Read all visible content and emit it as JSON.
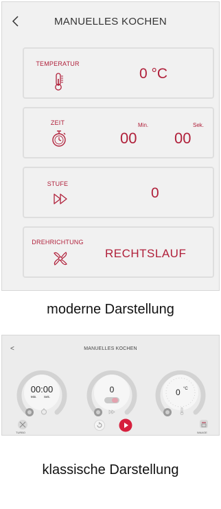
{
  "modern": {
    "back_glyph": "<",
    "title": "MANUELLES KOCHEN",
    "temperature": {
      "label": "TEMPERATUR",
      "value": "0 °C"
    },
    "time": {
      "label": "ZEIT",
      "minutes": "00",
      "minutes_unit": "Min.",
      "seconds": "00",
      "seconds_unit": "Sek."
    },
    "speed": {
      "label": "STUFE",
      "value": "0"
    },
    "direction": {
      "label": "DREHRICHTUNG",
      "value": "RECHTSLAUF"
    }
  },
  "caption_modern": "moderne Darstellung",
  "classic": {
    "back_glyph": "<",
    "title": "MANUELLES KOCHEN",
    "time_dial": {
      "value": "00:00",
      "min_label": "Min.",
      "sec_label": "Sek."
    },
    "speed_dial": {
      "value": "0"
    },
    "temp_dial": {
      "value": "0",
      "unit": "°C"
    },
    "turbo_label": "TURBO",
    "scale_label": "WAAGE"
  },
  "caption_classic": "klassische Darstellung",
  "colors": {
    "accent": "#b0203a",
    "panel_bg": "#f1f1f1",
    "classic_bg": "#ececec",
    "play": "#d61f3d"
  }
}
